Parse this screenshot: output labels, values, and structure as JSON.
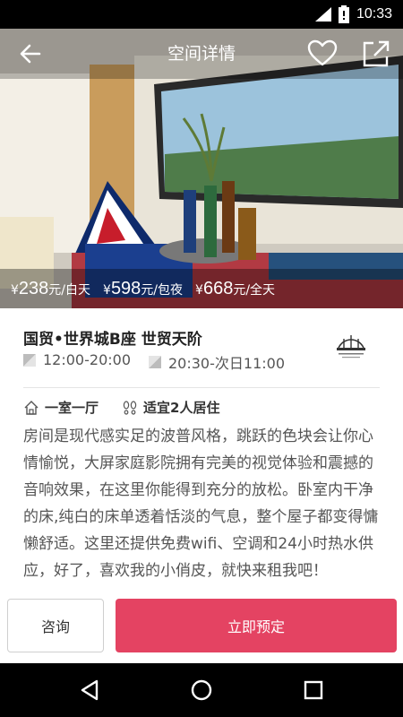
{
  "status_bar": {
    "time": "10:33",
    "icons": [
      "signal-icon",
      "battery-icon"
    ]
  },
  "header": {
    "title": "空间详情",
    "icons": [
      "back-arrow-icon",
      "heart-icon",
      "share-icon"
    ]
  },
  "prices": [
    {
      "currency": "¥",
      "amount": "238",
      "unit": "元/白天"
    },
    {
      "currency": "¥",
      "amount": "598",
      "unit": "元/包夜"
    },
    {
      "currency": "¥",
      "amount": "668",
      "unit": "元/全天"
    }
  ],
  "space": {
    "name": "国贸•世界城B座 世贸天阶",
    "day_time": "12:00-20:00",
    "night_time": "20:30-次日11:00"
  },
  "tags": [
    {
      "label": "一室一厅",
      "icon": "house-icon"
    },
    {
      "label": "适宜2人居住",
      "icon": "footprints-icon"
    }
  ],
  "description": "房间是现代感实足的波普风格，跳跃的色块会让你心情愉悦，大屏家庭影院拥有完美的视觉体验和震撼的音响效果，在这里你能得到充分的放松。卧室内干净的床,纯白的床单透着恬淡的气息，整个屋子都变得慵懒舒适。这里还提供免费wifi、空调和24小时热水供应，好了，喜欢我的小俏皮，就快来租我吧！",
  "actions": {
    "consult": "咨询",
    "book": "立即预定"
  },
  "colors": {
    "accent": "#e44362",
    "status_bar": "#000000"
  },
  "nav": [
    "back-triangle-icon",
    "home-circle-icon",
    "recents-square-icon"
  ]
}
